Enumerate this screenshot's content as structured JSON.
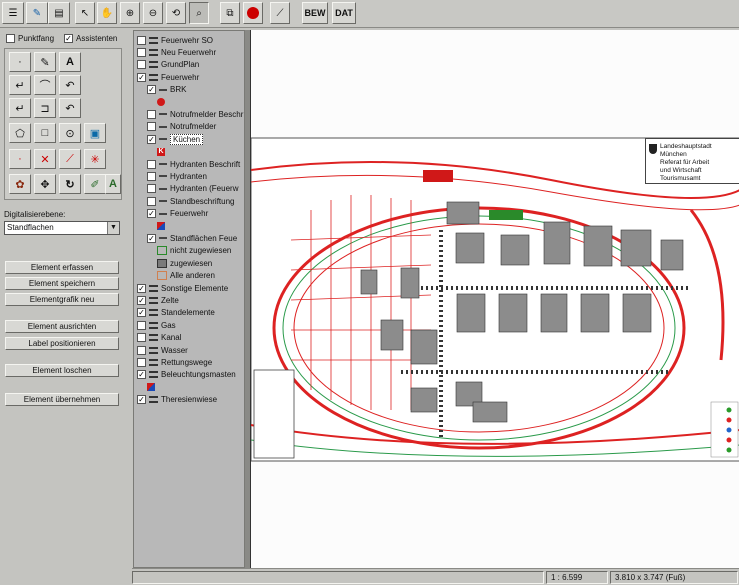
{
  "toolbar": {
    "icons": [
      "menu-icon",
      "draw-icon",
      "print-icon",
      "pointer-icon",
      "hand-icon",
      "zoom-icon",
      "zoom-out-icon",
      "zoom-back-icon",
      "zoom-window-icon",
      "copy-icon",
      "stop-icon",
      "line-tool-icon"
    ],
    "bew_label": "BEW",
    "dat_label": "DAT"
  },
  "options": {
    "punktfang_label": "Punktfang",
    "punktfang_checked": false,
    "assistenten_label": "Assistenten",
    "assistenten_checked": true
  },
  "digitize": {
    "label": "Digitalisierebene:",
    "value": "Standflachen"
  },
  "buttons": {
    "element_erfassen": "Element erfassen",
    "element_speichern": "Element speichern",
    "elementgrafik_neu": "Elementgrafik neu",
    "element_ausrichten": "Element ausrichten",
    "label_positionieren": "Label positionieren",
    "element_loschen": "Element loschen",
    "element_ubernehmen": "Element übernehmen"
  },
  "layers": [
    {
      "label": "Feuerwehr SO",
      "checked": false,
      "kind": "layer",
      "indent": 0
    },
    {
      "label": "Neu Feuerwehr",
      "checked": false,
      "kind": "layer",
      "indent": 0
    },
    {
      "label": "GrundPlan",
      "checked": false,
      "kind": "layer",
      "indent": 0
    },
    {
      "label": "Feuerwehr",
      "checked": true,
      "kind": "layer",
      "indent": 0
    },
    {
      "label": "BRK",
      "checked": true,
      "kind": "dash",
      "indent": 1
    },
    {
      "label": "",
      "kind": "icon-red",
      "indent": 2
    },
    {
      "label": "Notrufmelder Beschr",
      "checked": false,
      "kind": "dash",
      "indent": 1
    },
    {
      "label": "Notrufmelder",
      "checked": false,
      "kind": "dash",
      "indent": 1
    },
    {
      "label": "Küchen",
      "checked": true,
      "kind": "dash",
      "indent": 1,
      "selected": true
    },
    {
      "label": "K",
      "kind": "icon-k",
      "indent": 2
    },
    {
      "label": "Hydranten Beschrift",
      "checked": false,
      "kind": "dash",
      "indent": 1
    },
    {
      "label": "Hydranten",
      "checked": false,
      "kind": "dash",
      "indent": 1
    },
    {
      "label": "Hydranten (Feuerw",
      "checked": false,
      "kind": "dash",
      "indent": 1
    },
    {
      "label": "Standbeschriftung",
      "checked": false,
      "kind": "dash",
      "indent": 1
    },
    {
      "label": "Feuerwehr",
      "checked": true,
      "kind": "dash",
      "indent": 1
    },
    {
      "label": "",
      "kind": "icon-mix",
      "indent": 2
    },
    {
      "label": "Standflächen Feue",
      "checked": true,
      "kind": "dash",
      "indent": 1
    },
    {
      "label": "nicht zugewiesen",
      "kind": "swatch",
      "color": "#b8b8b8",
      "border": "#2a8a2a",
      "indent": 2
    },
    {
      "label": "zugewiesen",
      "kind": "swatch",
      "color": "#7a7a7a",
      "border": "#333333",
      "indent": 2
    },
    {
      "label": "Alle anderen",
      "kind": "swatch",
      "color": "#b8b8b8",
      "border": "#d08050",
      "indent": 2
    },
    {
      "label": "Sonstige Elemente",
      "checked": true,
      "kind": "layer",
      "indent": 0
    },
    {
      "label": "Zelte",
      "checked": true,
      "kind": "layer",
      "indent": 0
    },
    {
      "label": "Standelemente",
      "checked": true,
      "kind": "layer",
      "indent": 0
    },
    {
      "label": "Gas",
      "checked": false,
      "kind": "layer",
      "indent": 0
    },
    {
      "label": "Kanal",
      "checked": false,
      "kind": "layer",
      "indent": 0
    },
    {
      "label": "Wasser",
      "checked": false,
      "kind": "layer",
      "indent": 0
    },
    {
      "label": "Rettungswege",
      "checked": false,
      "kind": "layer",
      "indent": 0
    },
    {
      "label": "Beleuchtungsmasten",
      "checked": true,
      "kind": "layer",
      "indent": 0
    },
    {
      "label": "",
      "kind": "icon-mix",
      "indent": 1
    },
    {
      "label": "Theresienwiese",
      "checked": true,
      "kind": "layer",
      "indent": 0
    }
  ],
  "map": {
    "legend_lines": [
      "Landeshauptstadt",
      "München",
      "Referat für Arbeit",
      "und Wirtschaft",
      "",
      "Tourismusamt"
    ]
  },
  "status": {
    "scale": "1 : 6.599",
    "dimensions": "3.810 x 3.747 (Fuß)"
  }
}
